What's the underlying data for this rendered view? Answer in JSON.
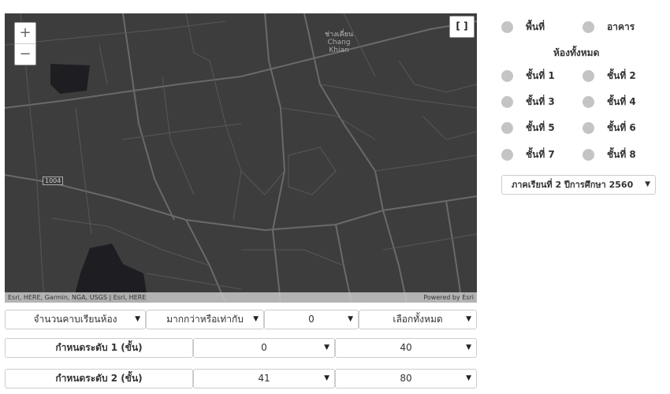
{
  "map": {
    "zoom_in": "+",
    "zoom_out": "−",
    "fullscreen": "[ ]",
    "place_th": "ช่างเคี่ยน",
    "place_en1": "Chang",
    "place_en2": "Khian",
    "road_shield": "1004",
    "attribution_left": "Esri, HERE, Garmin, NGA, USGS | Esri, HERE",
    "attribution_right": "Powered by Esri",
    "colors": {
      "background": "#3d3d3d",
      "roads": "#6a6a6a",
      "water": "#1e1e22"
    }
  },
  "filter": {
    "row1": [
      "จำนวนคาบเรียนห้อง",
      "มากกว่าหรือเท่ากับ",
      "0",
      "เลือกทั้งหมด"
    ],
    "level1": {
      "label": "กำหนดระดับ 1 (ขั้น)",
      "min": "0",
      "max": "40"
    },
    "level2": {
      "label": "กำหนดระดับ 2 (ขั้น)",
      "min": "41",
      "max": "80"
    }
  },
  "layers": {
    "area": "พื้นที่",
    "building": "อาคาร",
    "rooms_heading": "ห้องทั้งหมด",
    "floors": [
      "ชั้นที่ 1",
      "ชั้นที่ 2",
      "ชั้นที่ 3",
      "ชั้นที่ 4",
      "ชั้นที่ 5",
      "ชั้นที่ 6",
      "ชั้นที่ 7",
      "ชั้นที่ 8"
    ]
  },
  "semester": {
    "selected": "ภาคเรียนที่ 2 ปีการศึกษา 2560"
  }
}
